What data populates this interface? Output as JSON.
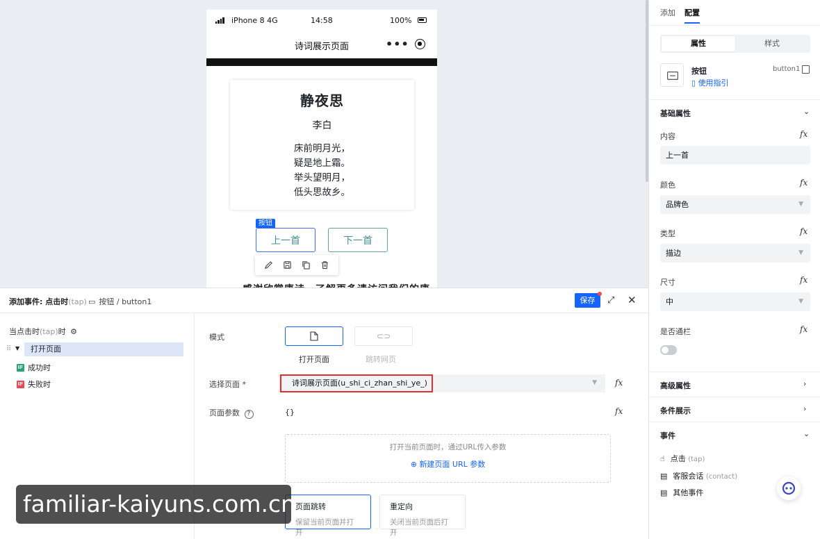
{
  "phone": {
    "carrier": "iPhone 8  4G",
    "time": "14:58",
    "battery": "100%",
    "nav_title": "诗词展示页面",
    "more_label": "•••"
  },
  "poem": {
    "title": "静夜思",
    "author": "李白",
    "lines": [
      "床前明月光，",
      "疑是地上霜。",
      "举头望明月，",
      "低头思故乡。"
    ]
  },
  "buttons": {
    "selected_tag": "按钮",
    "prev": "上一首",
    "next": "下一首"
  },
  "cut_text": "感谢欣赏唐诗，了解更多请访问我们的唐",
  "right_panel": {
    "tabs": [
      "添加",
      "配置"
    ],
    "active_tab": "配置",
    "segments": [
      "属性",
      "样式"
    ],
    "component_name": "按钮",
    "guide_link": "使用指引",
    "component_id": "button1",
    "basic_section": "基础属性",
    "props": {
      "content_label": "内容",
      "content_value": "上一首",
      "color_label": "颜色",
      "color_value": "品牌色",
      "type_label": "类型",
      "type_value": "描边",
      "size_label": "尺寸",
      "size_value": "中",
      "block_label": "是否通栏"
    },
    "advanced_section": "高级属性",
    "condition_section": "条件展示",
    "events_section": "事件",
    "events": [
      {
        "name": "点击",
        "hint": "(tap)"
      },
      {
        "name": "客服会话",
        "hint": "(contact)"
      },
      {
        "name": "其他事件",
        "hint": ""
      }
    ],
    "fx_label": "fx"
  },
  "event_panel": {
    "title": "添加事件: 点击时",
    "title_hint": "(tap)",
    "component_path": "按钮 / button1",
    "save_label": "保存",
    "trigger_label": "当点击时",
    "trigger_hint": "(tap)",
    "trigger_suffix": "时",
    "action": "打开页面",
    "success_badge": "IF",
    "success_label": "成功时",
    "fail_badge": "IF",
    "fail_label": "失败时",
    "mode_label": "模式",
    "mode_open": "打开页面",
    "mode_jump": "跳转网页",
    "select_page_label": "选择页面 *",
    "select_page_value": "诗词展示页面(u_shi_ci_zhan_shi_ye_)",
    "params_label": "页面参数",
    "params_value": "{}",
    "params_hint": "打开当前页面时，通过URL传入参数",
    "params_add": "新建页面 URL 参数",
    "nav_option1_title": "页面跳转",
    "nav_option1_desc": "保留当前页面并打开",
    "nav_option2_title": "重定向",
    "nav_option2_desc": "关闭当前页面后打开"
  },
  "watermark": "familiar-kaiyuns.com.cn",
  "colors": {
    "brand_blue": "#1664ff",
    "button_text_teal": "#4a8d94",
    "highlight_red": "#e0302d"
  }
}
